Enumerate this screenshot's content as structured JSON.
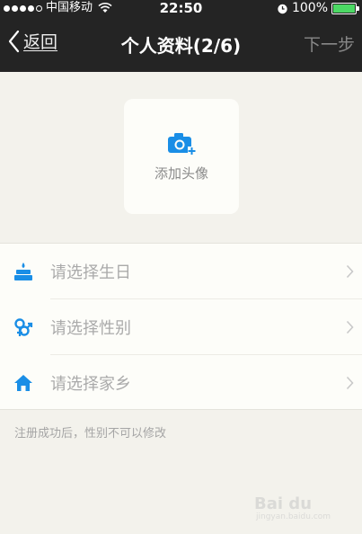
{
  "status_bar": {
    "carrier": "中国移动",
    "time": "22:50",
    "battery_percent": "100%",
    "battery_level": 1.0,
    "signal_bars_filled": 4,
    "signal_bars_total": 5
  },
  "nav": {
    "back_label": "返回",
    "title": "个人资料(2/6)",
    "next_label": "下一步"
  },
  "avatar": {
    "label": "添加头像",
    "icon": "camera-plus-icon"
  },
  "fields": [
    {
      "label": "请选择生日",
      "icon": "cake-icon"
    },
    {
      "label": "请选择性别",
      "icon": "gender-icon"
    },
    {
      "label": "请选择家乡",
      "icon": "home-icon"
    }
  ],
  "note": "注册成功后，性别不可以修改",
  "watermark": {
    "brand": "Bai du",
    "sub": "jingyan.baidu.com"
  },
  "colors": {
    "accent": "#1a8ee6",
    "nav_bg": "#242424",
    "page_bg": "#f3f2ec",
    "battery": "#4cd964"
  }
}
